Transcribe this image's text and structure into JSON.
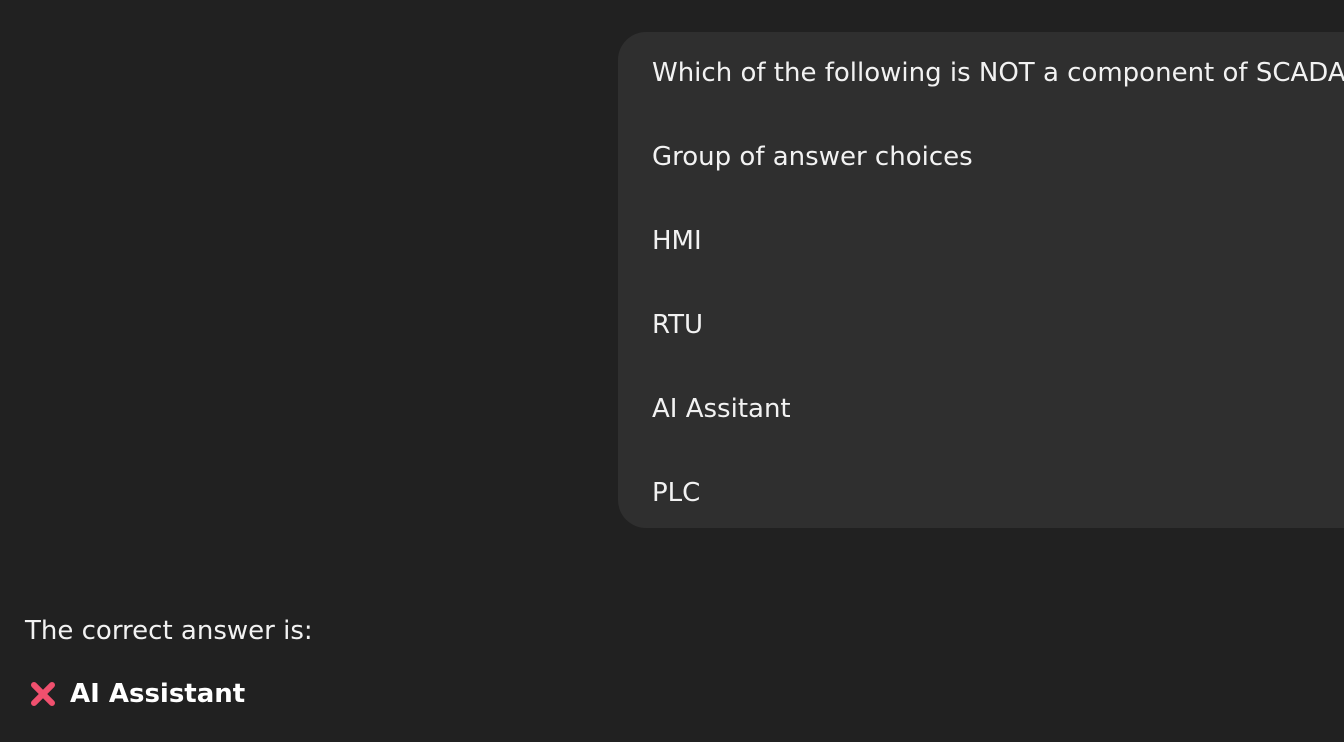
{
  "user_message": {
    "question": "Which of the following is NOT a component of SCADA?",
    "group_label": "Group of answer choices",
    "choices": [
      "HMI",
      "RTU",
      "AI Assitant",
      "PLC"
    ]
  },
  "assistant_message": {
    "intro": "The correct answer is:",
    "answer_icon": "cross-mark-icon",
    "answer_icon_color": "#f0506e",
    "answer": "AI Assistant"
  },
  "colors": {
    "background": "#212121",
    "user_bubble": "#2f2f2f",
    "text": "#f2f2f2"
  }
}
